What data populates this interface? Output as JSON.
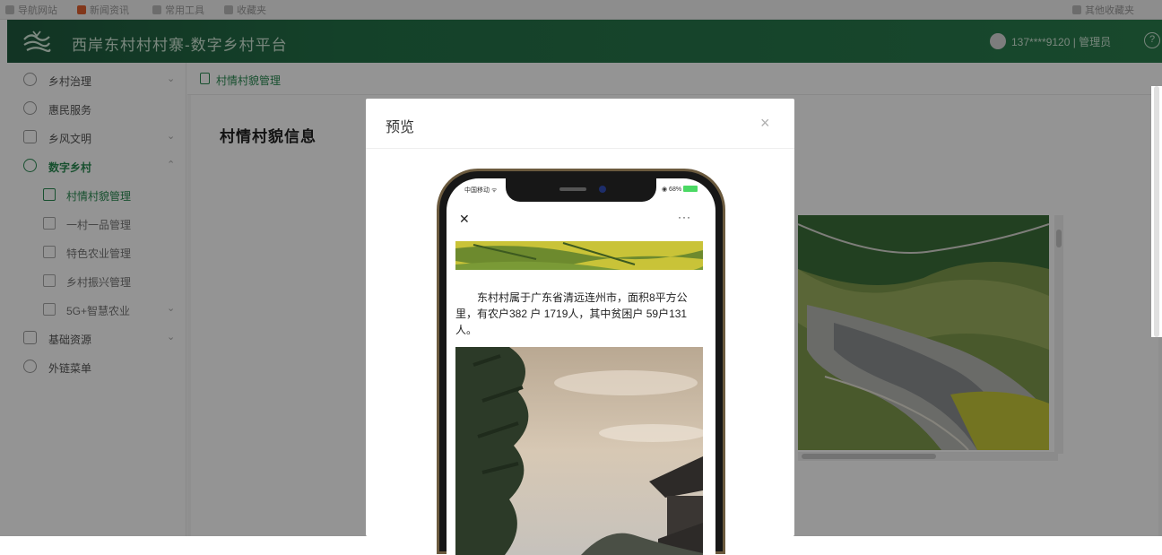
{
  "browser": {
    "bookmarks": [
      "导航网站",
      "新闻资讯",
      "常用工具",
      "收藏夹"
    ],
    "right_label": "其他收藏夹"
  },
  "header": {
    "title": "西岸东村村村寨-数字乡村平台",
    "user": "137****9120 | 管理员",
    "help_glyph": "?"
  },
  "sidebar": {
    "items": [
      {
        "label": "乡村治理",
        "icon": "map-icon",
        "arrow": "⌄"
      },
      {
        "label": "惠民服务",
        "icon": "heart-icon",
        "arrow": ""
      },
      {
        "label": "乡风文明",
        "icon": "book-icon",
        "arrow": "⌄"
      },
      {
        "label": "数字乡村",
        "icon": "leaf-icon",
        "arrow": "⌃"
      },
      {
        "label": "基础资源",
        "icon": "database-icon",
        "arrow": "⌄"
      },
      {
        "label": "外链菜单",
        "icon": "link-icon",
        "arrow": ""
      }
    ],
    "subitems": [
      {
        "label": "村情村貌管理",
        "icon": "house-icon"
      },
      {
        "label": "一村一品管理",
        "icon": "grid-icon"
      },
      {
        "label": "特色农业管理",
        "icon": "sprout-icon"
      },
      {
        "label": "乡村振兴管理",
        "icon": "chart-icon"
      },
      {
        "label": "5G+智慧农业",
        "icon": "signal-icon"
      }
    ],
    "sub_arrow": "⌄"
  },
  "main": {
    "breadcrumb": "村情村貌管理",
    "page_title": "村情村貌信息"
  },
  "modal": {
    "title": "预览",
    "close_glyph": "×",
    "phone": {
      "status_left": "中国移动 ᯤ",
      "status_right": "◉ 68%",
      "close_glyph": "✕",
      "more_glyph": "···",
      "intro_text": "东村村属于广东省清远连州市，面积8平方公里，有农户382 户 1719人，其中贫困户 59户131人。"
    }
  },
  "colors": {
    "header_green": "#247148",
    "accent_green": "#2a8a52"
  }
}
